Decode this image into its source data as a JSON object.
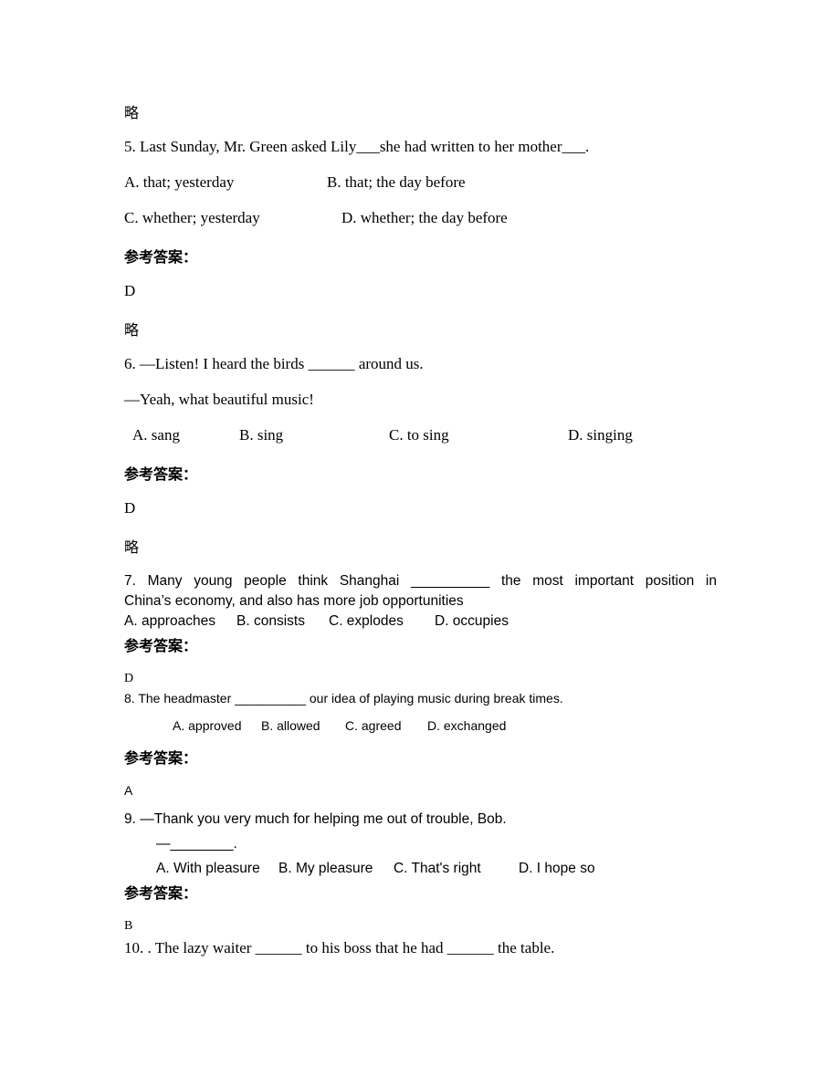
{
  "answer_label": "参考答案：",
  "omitted": "略",
  "top_note": "略",
  "questions": [
    {
      "number": "5",
      "stem": "5. Last Sunday, Mr. Green asked Lily___she had written to her mother___.",
      "options": [
        "A. that; yesterday",
        "B. that; the day before",
        "C. whether; yesterday",
        "D. whether; the day before"
      ],
      "answer": "D",
      "explanation": "略"
    },
    {
      "number": "6",
      "stem": "6. —Listen! I heard the birds ______ around us.",
      "stem_line2": "—Yeah, what beautiful music!",
      "options": [
        "A. sang",
        "B. sing",
        "C. to sing",
        "D. singing"
      ],
      "answer": "D",
      "explanation": "略"
    },
    {
      "number": "7",
      "stem": "7. Many young people think Shanghai __________ the most important position in",
      "stem_line2": "China’s economy, and also has more job opportunities",
      "options": [
        "A. approaches",
        "B. consists",
        "C. explodes",
        "D. occupies"
      ],
      "answer": "D"
    },
    {
      "number": "8",
      "stem": "8. The headmaster __________ our idea of playing music during break times.",
      "options": [
        "A. approved",
        "B. allowed",
        "C. agreed",
        "D. exchanged"
      ],
      "answer": "A"
    },
    {
      "number": "9",
      "stem": "9. —Thank you very much for helping me out of trouble, Bob.",
      "stem_line2": "—________.",
      "options": [
        "A. With pleasure",
        "B. My pleasure",
        "C. That's right",
        "D. I hope so"
      ],
      "answer": "B"
    },
    {
      "number": "10",
      "stem": "10. .  The lazy waiter ______ to his boss that he had ______ the table."
    }
  ]
}
